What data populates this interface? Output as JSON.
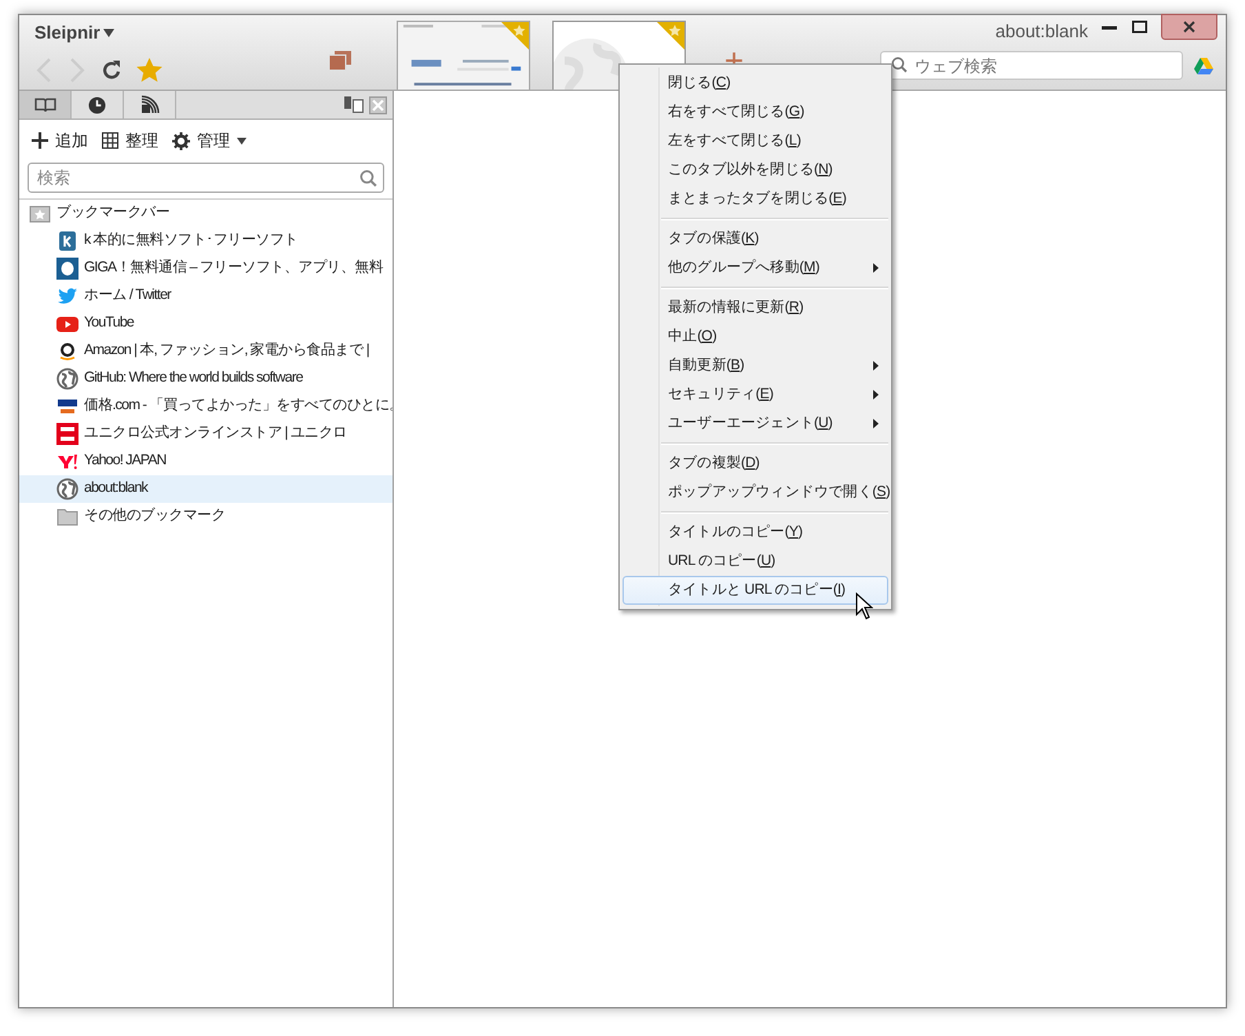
{
  "window": {
    "app_name": "Sleipnir",
    "title": "about:blank"
  },
  "search": {
    "placeholder": "ウェブ検索"
  },
  "tabs": [
    {
      "kind": "page",
      "selected": false
    },
    {
      "kind": "blank",
      "selected": true
    }
  ],
  "new_tab": "+",
  "sidebar": {
    "tabs": [
      {
        "kind": "bookmarks",
        "selected": true
      },
      {
        "kind": "history",
        "selected": false
      },
      {
        "kind": "feeds",
        "selected": false
      }
    ],
    "actions": [
      {
        "kind": "add",
        "label": "追加"
      },
      {
        "kind": "organize",
        "label": "整理"
      },
      {
        "kind": "manage",
        "label": "管理"
      }
    ],
    "search": {
      "placeholder": "検索"
    },
    "tree": [
      {
        "label": "ブックマークバー",
        "kind": "bar",
        "selected": false,
        "children": [
          {
            "label": "k 本的に無料ソフト･フリーソフト",
            "kind": "k",
            "selected": false
          },
          {
            "label": "GIGA！無料通信 – フリーソフト、アプリ、無料",
            "kind": "giga",
            "selected": false
          },
          {
            "label": "ホーム / Twitter",
            "kind": "bird",
            "selected": false
          },
          {
            "label": "YouTube",
            "kind": "play",
            "selected": false
          },
          {
            "label": "Amazon | 本, ファッション, 家電から食品まで |",
            "kind": "a",
            "selected": false
          },
          {
            "label": "GitHub: Where the world builds software",
            "kind": "globe",
            "selected": false
          },
          {
            "label": "価格.com - 「買ってよかった」をすべてのひとに。",
            "kind": "kakaku",
            "selected": false
          },
          {
            "label": "ユニクロ公式オンラインストア | ユニクロ",
            "kind": "uniqlo",
            "selected": false
          },
          {
            "label": "Yahoo! JAPAN",
            "kind": "yahoo",
            "selected": false
          },
          {
            "label": "about:blank",
            "kind": "globe",
            "selected": true
          },
          {
            "label": "その他のブックマーク",
            "kind": "folder",
            "selected": false
          }
        ]
      }
    ]
  },
  "context_menu": {
    "groups": [
      [
        {
          "before": "閉じる(",
          "key": "C",
          "after": ")",
          "submenu": false,
          "highlighted": false
        },
        {
          "before": "右をすべて閉じる(",
          "key": "G",
          "after": ")",
          "submenu": false,
          "highlighted": false
        },
        {
          "before": "左をすべて閉じる(",
          "key": "L",
          "after": ")",
          "submenu": false,
          "highlighted": false
        },
        {
          "before": "このタブ以外を閉じる(",
          "key": "N",
          "after": ")",
          "submenu": false,
          "highlighted": false
        },
        {
          "before": "まとまったタブを閉じる(",
          "key": "E",
          "after": ")",
          "submenu": false,
          "highlighted": false
        }
      ],
      [
        {
          "before": "タブの保護(",
          "key": "K",
          "after": ")",
          "submenu": false,
          "highlighted": false
        },
        {
          "before": "他のグループへ移動(",
          "key": "M",
          "after": ")",
          "submenu": true,
          "highlighted": false
        }
      ],
      [
        {
          "before": "最新の情報に更新(",
          "key": "R",
          "after": ")",
          "submenu": false,
          "highlighted": false
        },
        {
          "before": "中止(",
          "key": "O",
          "after": ")",
          "submenu": false,
          "highlighted": false
        },
        {
          "before": "自動更新(",
          "key": "B",
          "after": ")",
          "submenu": true,
          "highlighted": false
        },
        {
          "before": "セキュリティ(",
          "key": "E",
          "after": ")",
          "submenu": true,
          "highlighted": false
        },
        {
          "before": "ユーザーエージェント(",
          "key": "U",
          "after": ")",
          "submenu": true,
          "highlighted": false
        }
      ],
      [
        {
          "before": "タブの複製(",
          "key": "D",
          "after": ")",
          "submenu": false,
          "highlighted": false
        },
        {
          "before": "ポップアップウィンドウで開く(",
          "key": "S",
          "after": ")",
          "submenu": false,
          "highlighted": false
        }
      ],
      [
        {
          "before": "タイトルのコピー(",
          "key": "Y",
          "after": ")",
          "submenu": false,
          "highlighted": false
        },
        {
          "before": "URL のコピー(",
          "key": "U",
          "after": ")",
          "submenu": false,
          "highlighted": false
        },
        {
          "before": "タイトルと URL のコピー(",
          "key": "I",
          "after": ")",
          "submenu": false,
          "highlighted": true
        }
      ]
    ]
  }
}
